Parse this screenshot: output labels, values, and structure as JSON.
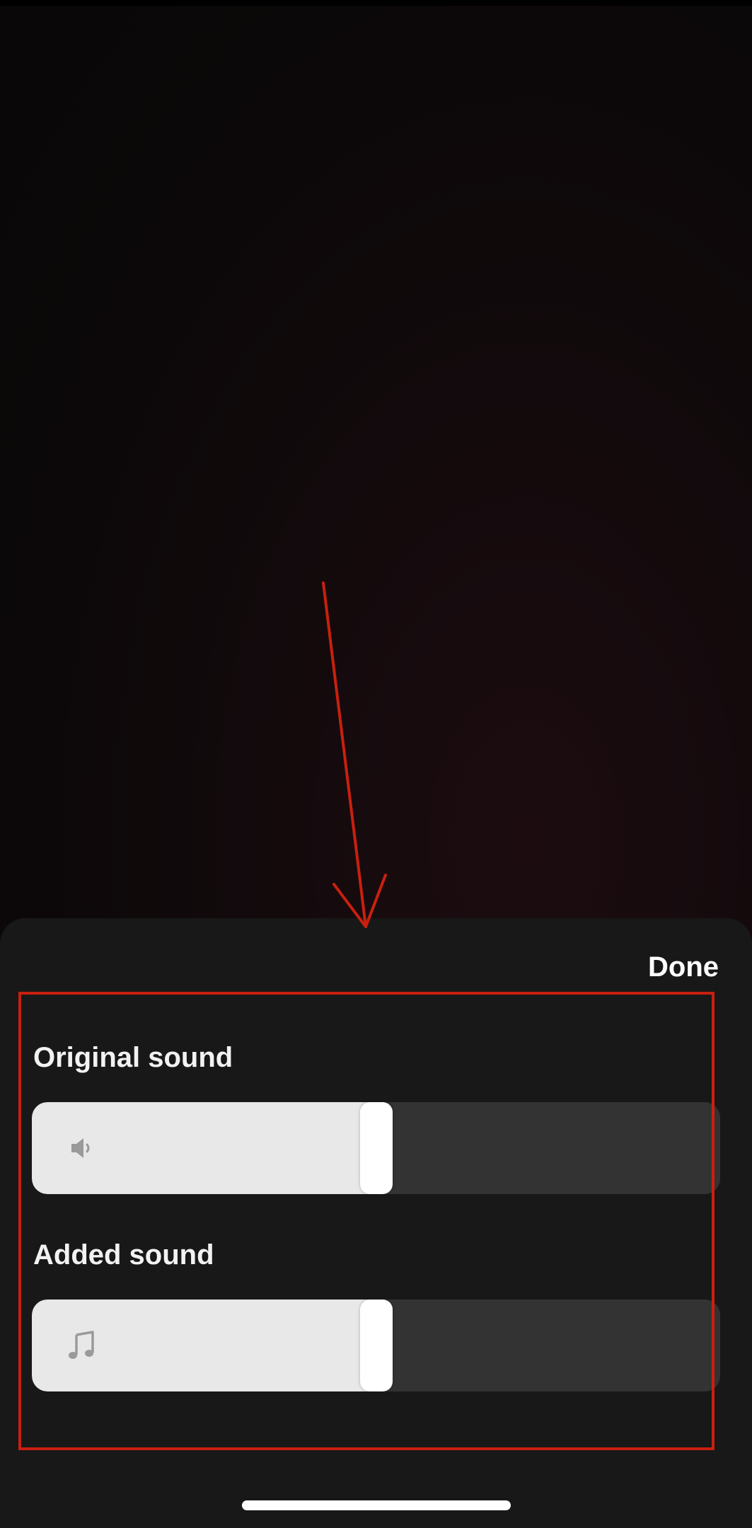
{
  "header": {
    "done_label": "Done"
  },
  "original_sound": {
    "label": "Original sound",
    "icon": "speaker-icon",
    "level_percent": 50
  },
  "added_sound": {
    "label": "Added sound",
    "icon": "music-note-icon",
    "level_percent": 50
  },
  "colors": {
    "sheet_background": "#181818",
    "slider_track": "#333333",
    "slider_fill": "#e8e8e8",
    "slider_thumb": "#ffffff",
    "icon": "#9a9a9a",
    "annotation": "#c8200f"
  }
}
